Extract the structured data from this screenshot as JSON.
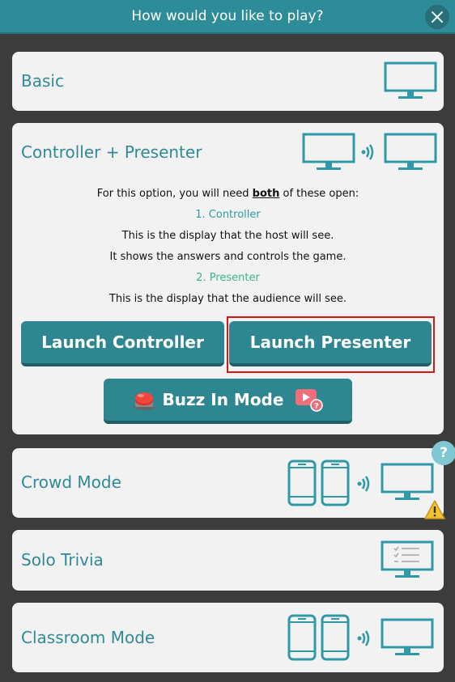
{
  "header": {
    "title": "How would you like to play?",
    "close_icon": "close-icon"
  },
  "options": {
    "basic": {
      "label": "Basic"
    },
    "controller_presenter": {
      "label": "Controller + Presenter",
      "intro_prefix": "For this option, you will need ",
      "intro_bold": "both",
      "intro_suffix": " of these open:",
      "step1_title": "1. Controller",
      "step1_line1": "This is the display that the host will see.",
      "step1_line2": "It shows the answers and controls the game.",
      "step2_title": "2. Presenter",
      "step2_line1": "This is the display that the audience will see.",
      "launch_controller": "Launch Controller",
      "launch_presenter": "Launch Presenter",
      "buzz_in": "Buzz In Mode"
    },
    "crowd": {
      "label": "Crowd Mode",
      "help": "?"
    },
    "solo": {
      "label": "Solo Trivia"
    },
    "classroom": {
      "label": "Classroom Mode"
    }
  },
  "colors": {
    "header": "#2e8c98",
    "background": "#3c3c3c",
    "card": "#f2f2f2",
    "accent": "#2f8a96",
    "button": "#2e8691",
    "highlight": "#d01818",
    "warning": "#f2c230"
  }
}
